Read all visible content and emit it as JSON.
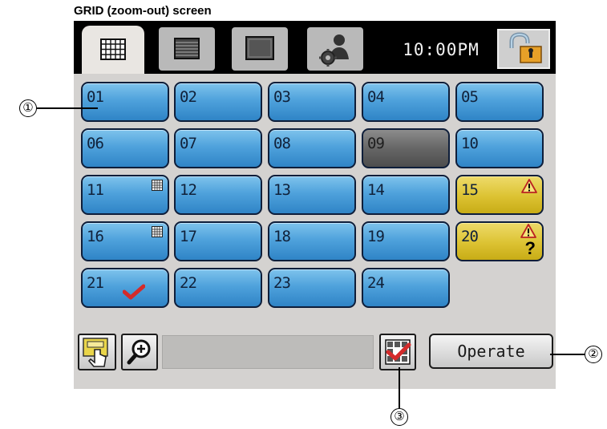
{
  "caption": "GRID (zoom-out) screen",
  "topbar": {
    "tabs": [
      {
        "name": "grid",
        "icon": "grid-icon",
        "active": true
      },
      {
        "name": "list",
        "icon": "list-icon",
        "active": false
      },
      {
        "name": "single",
        "icon": "single-window-icon",
        "active": false
      },
      {
        "name": "settings",
        "icon": "user-settings-icon",
        "active": false
      }
    ],
    "time": "10:00PM",
    "lock_icon": "unlock-icon"
  },
  "grid": {
    "cells": [
      {
        "label": "01",
        "state": "normal"
      },
      {
        "label": "02",
        "state": "normal"
      },
      {
        "label": "03",
        "state": "normal"
      },
      {
        "label": "04",
        "state": "normal"
      },
      {
        "label": "05",
        "state": "normal"
      },
      {
        "label": "06",
        "state": "normal"
      },
      {
        "label": "07",
        "state": "normal"
      },
      {
        "label": "08",
        "state": "normal"
      },
      {
        "label": "09",
        "state": "disabled"
      },
      {
        "label": "10",
        "state": "normal"
      },
      {
        "label": "11",
        "state": "normal",
        "badge": "group-grid-icon"
      },
      {
        "label": "12",
        "state": "normal"
      },
      {
        "label": "13",
        "state": "normal"
      },
      {
        "label": "14",
        "state": "normal"
      },
      {
        "label": "15",
        "state": "warning",
        "badge": "warning-icon"
      },
      {
        "label": "16",
        "state": "normal",
        "badge": "group-grid-icon"
      },
      {
        "label": "17",
        "state": "normal"
      },
      {
        "label": "18",
        "state": "normal"
      },
      {
        "label": "19",
        "state": "normal"
      },
      {
        "label": "20",
        "state": "warning",
        "badge": "warning-unknown-icon"
      },
      {
        "label": "21",
        "state": "selected",
        "badge": "check-icon"
      },
      {
        "label": "22",
        "state": "normal"
      },
      {
        "label": "23",
        "state": "normal"
      },
      {
        "label": "24",
        "state": "normal"
      }
    ]
  },
  "bottombar": {
    "select_icon": "touch-select-icon",
    "zoom_icon": "zoom-in-icon",
    "multi_select_icon": "multi-select-check-icon",
    "operate_label": "Operate"
  },
  "callouts": {
    "one": "①",
    "two": "②",
    "three": "③"
  },
  "colors": {
    "cell_blue": "#4fa2dc",
    "cell_gray": "#666666",
    "cell_yellow": "#dcc232",
    "check_red": "#d42b2b",
    "topbar": "#000000"
  }
}
